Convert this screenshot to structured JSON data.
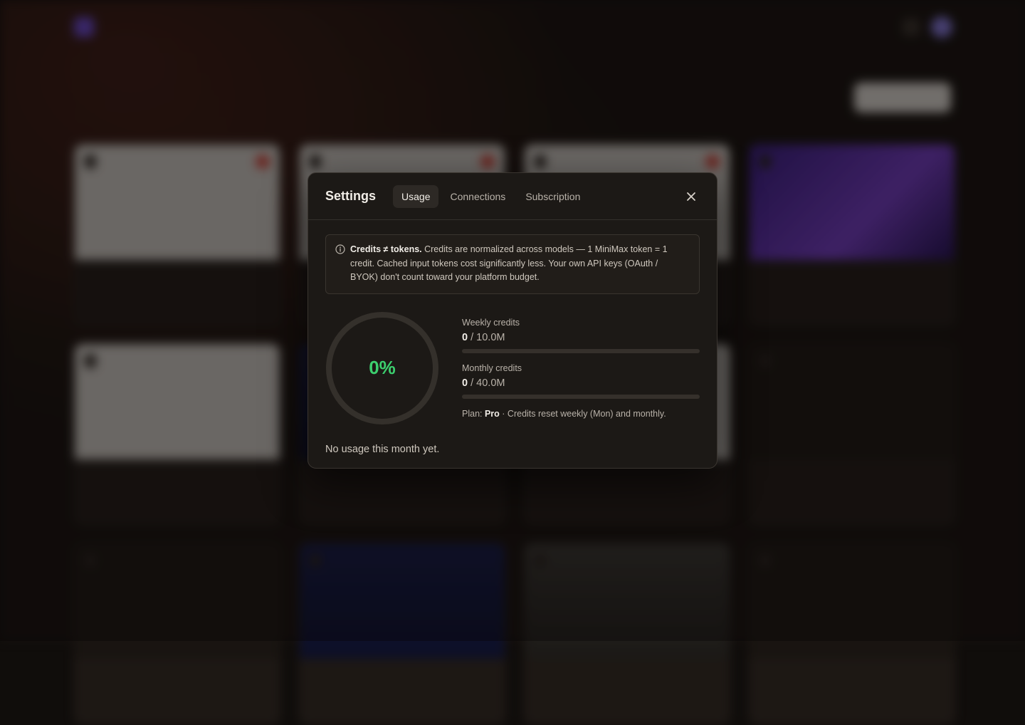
{
  "background": {
    "brand": "",
    "nav": [
      "",
      "",
      "",
      ""
    ],
    "page_title": "",
    "page_subtitle": "",
    "new_project_label": "",
    "cards": [
      {
        "thumb": "light"
      },
      {
        "thumb": "light"
      },
      {
        "thumb": "light"
      },
      {
        "thumb": "purple"
      },
      {
        "thumb": "light"
      },
      {
        "thumb": "navy"
      },
      {
        "thumb": "light"
      },
      {
        "thumb": "dark"
      },
      {
        "thumb": "dark"
      },
      {
        "thumb": "navy"
      },
      {
        "thumb": "gray"
      },
      {
        "thumb": "dark"
      }
    ]
  },
  "modal": {
    "title": "Settings",
    "tabs": [
      {
        "label": "Usage",
        "active": true
      },
      {
        "label": "Connections",
        "active": false
      },
      {
        "label": "Subscription",
        "active": false
      }
    ],
    "close_icon": "close-icon",
    "notice": {
      "icon": "info-icon",
      "strong": "Credits ≠ tokens.",
      "text": " Credits are normalized across models — 1 MiniMax token = 1 credit. Cached input tokens cost significantly less. Your own API keys (OAuth / BYOK) don't count toward your platform budget."
    },
    "usage": {
      "percent_label": "0%",
      "percent": 0,
      "weekly": {
        "label": "Weekly credits",
        "used": "0",
        "limit": "10.0M",
        "fraction": 0
      },
      "monthly": {
        "label": "Monthly credits",
        "used": "0",
        "limit": "40.0M",
        "fraction": 0
      },
      "plan_prefix": "Plan: ",
      "plan_name": "Pro",
      "plan_suffix": " · Credits reset weekly (Mon) and monthly.",
      "empty_note": "No usage this month yet."
    }
  },
  "colors": {
    "accent_green": "#3ccf6e",
    "modal_bg": "#1c1916"
  }
}
